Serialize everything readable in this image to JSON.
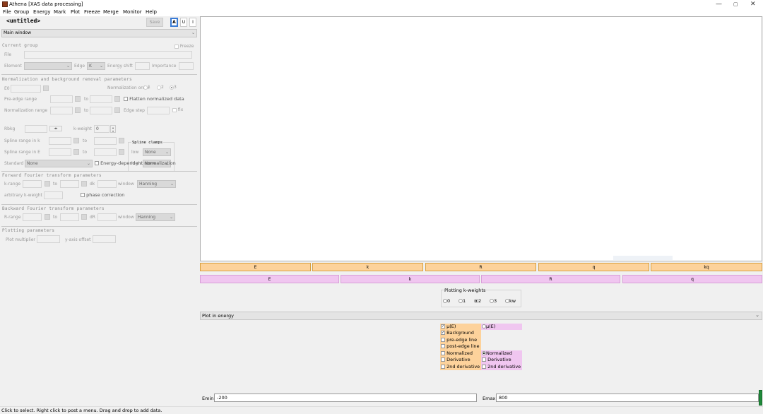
{
  "window": {
    "title": "Athena [XAS data processing]",
    "min": "—",
    "max": "▢",
    "close": "✕"
  },
  "menu": [
    "File",
    "Group",
    "Energy",
    "Mark",
    "Plot",
    "Freeze",
    "Merge",
    "Monitor",
    "Help"
  ],
  "project": {
    "name": "<untitled>",
    "save_label": "Save",
    "mark_buttons": [
      "A",
      "U",
      "I"
    ]
  },
  "main_selector": "Main window",
  "current_group": {
    "heading": "Current group",
    "freeze_label": "Freeze",
    "file_label": "File",
    "element_label": "Element",
    "edge_label": "Edge",
    "edge_value": "K",
    "energy_shift_label": "Energy shift",
    "importance_label": "Importance"
  },
  "normalization": {
    "heading": "Normalization and background removal parameters",
    "e0_label": "E0",
    "norm_order_label": "Normalization order",
    "norm_orders": [
      "1",
      "2",
      "3"
    ],
    "norm_order_selected": "3",
    "pre_edge_label": "Pre-edge range",
    "to": "to",
    "flatten_label": "Flatten normalized data",
    "norm_range_label": "Normalization range",
    "edge_step_label": "Edge step",
    "fix_label": "fix",
    "rbkg_label": "Rbkg",
    "kweight_label": "k-weight",
    "kweight_value": "0",
    "spline_clamps_label": "Spline clamps",
    "low_label": "low",
    "high_label": "high",
    "clamp_low": "None",
    "clamp_high": "None",
    "spline_k_label": "Spline range in k",
    "spline_e_label": "Spline range in E",
    "standard_label": "Standard",
    "standard_value": "None",
    "energy_dep_label": "Energy-dependent normalization"
  },
  "forward_ft": {
    "heading": "Forward Fourier transform parameters",
    "krange_label": "k-range",
    "to": "to",
    "dk_label": "dk",
    "window_label": "window",
    "window_value": "Hanning",
    "arb_kweight_label": "arbitrary k-weight",
    "phase_label": "phase correction"
  },
  "backward_ft": {
    "heading": "Backward Fourier transform parameters",
    "rrange_label": "R-range",
    "to": "to",
    "dr_label": "dR",
    "window_label": "window",
    "window_value": "Hanning"
  },
  "plotting": {
    "heading": "Plotting parameters",
    "multiplier_label": "Plot multiplier",
    "offset_label": "y-axis offset"
  },
  "plot_buttons_orange": [
    "E",
    "k",
    "R",
    "q",
    "kq"
  ],
  "plot_buttons_pink": [
    "E",
    "k",
    "R",
    "q"
  ],
  "kweights": {
    "title": "Plotting k-weights",
    "options": [
      "0",
      "1",
      "2",
      "3",
      "kw"
    ],
    "selected": "2"
  },
  "plot_tab": "Plot in energy",
  "energy_options_left": [
    {
      "label": "μ(E)",
      "checked": true
    },
    {
      "label": "Background",
      "checked": true
    },
    {
      "label": "pre-edge line",
      "checked": false
    },
    {
      "label": "post-edge line",
      "checked": false
    },
    {
      "label": "Normalized",
      "checked": false
    },
    {
      "label": "Derivative",
      "checked": false
    },
    {
      "label": "2nd derivative",
      "checked": false
    }
  ],
  "energy_options_right": {
    "mu_label": "μ(E)",
    "normalized_label": "Normalized",
    "derivative_label": "Derivative",
    "second_label": "2nd derivative"
  },
  "emin": {
    "label": "Emin",
    "value": "-200"
  },
  "emax": {
    "label": "Emax",
    "value": "800"
  },
  "status": "Click to select. Right click to post a menu. Drag and drop to add data."
}
